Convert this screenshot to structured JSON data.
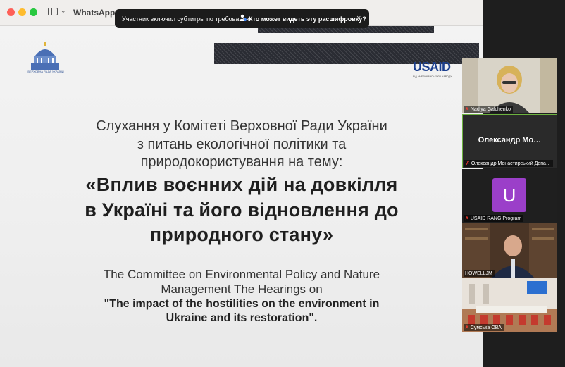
{
  "window": {
    "title": "WhatsApp In",
    "traffic_lights": {
      "close": "#fe5f57",
      "minimize": "#febc2e",
      "zoom": "#28c840"
    }
  },
  "notification": {
    "message": "Участник включил субтитры по требованию",
    "link_label": "Кто может видеть эту расшифровку?",
    "close_glyph": "×"
  },
  "slide": {
    "parliament_caption": "ВЕРХОВНА РАДА УКРАЇНИ",
    "usaid_logo": "USAID",
    "usaid_sub": "ВІД АМЕРИКАНСЬКОГО НАРОДУ",
    "ua_lines": [
      "Слухання у Комітеті Верховної Ради України",
      "з питань екологічної політики та",
      "природокористування на тему:"
    ],
    "title_lines": [
      "«Вплив воєнних дій на довкілля",
      "в Україні та його відновлення до",
      "природного стану»"
    ],
    "en_lines": [
      "The Committee on Environmental Policy and Nature",
      "Management  The Hearings  on"
    ],
    "en_bold_lines": [
      "\"The impact of the hostilities on the environment in",
      "Ukraine and its restoration\"."
    ]
  },
  "participants": [
    {
      "name": "Nadiya Galchenko",
      "muted": true,
      "type": "video"
    },
    {
      "name": "Олександр Монастирський Депа…",
      "display": "Олександр  Мо…",
      "muted": true,
      "type": "name",
      "active_speaker": true
    },
    {
      "name": "USAID RANG Program",
      "avatar_letter": "U",
      "avatar_color": "#9b3fc9",
      "muted": true,
      "type": "avatar"
    },
    {
      "name": "HOWELLJM",
      "muted": false,
      "type": "video"
    },
    {
      "name": "Сумська ОВА",
      "muted": true,
      "type": "video"
    }
  ],
  "colors": {
    "active_border": "#6db33f",
    "mic_muted": "#ff3b30",
    "stripe": "#2a2c33"
  }
}
